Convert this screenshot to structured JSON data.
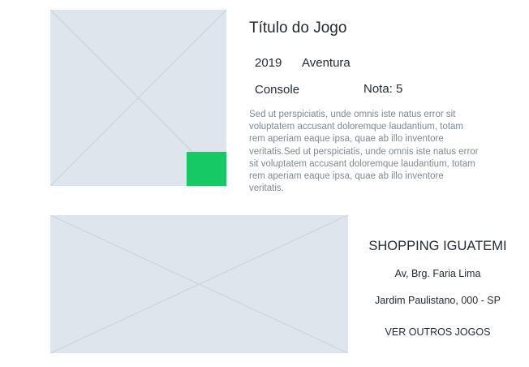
{
  "game": {
    "title": "Título do Jogo",
    "year": "2019",
    "genre": "Aventura",
    "platform": "Console",
    "rating": "Nota: 5",
    "description": "Sed ut perspiciatis, unde omnis iste natus error sit voluptatem accusant doloremque laudantium, totam rem aperiam eaque ipsa, quae ab illo inventore veritatis.Sed ut perspiciatis, unde omnis iste natus error sit voluptatem accusant doloremque laudantium, totam rem aperiam eaque ipsa, quae ab illo inventore veritatis.",
    "badge_color": "#16c964"
  },
  "store": {
    "name": "SHOPPING IGUATEMI",
    "street": "Av, Brg. Faria Lima",
    "district": "Jardim Paulistano, 000 -  SP",
    "more_games_label": "VER OUTROS JOGOS"
  },
  "colors": {
    "placeholder_bg": "#dfe5ec",
    "placeholder_line": "#c9d1da",
    "text_dark": "#232a33",
    "text_muted": "#7f8892"
  }
}
